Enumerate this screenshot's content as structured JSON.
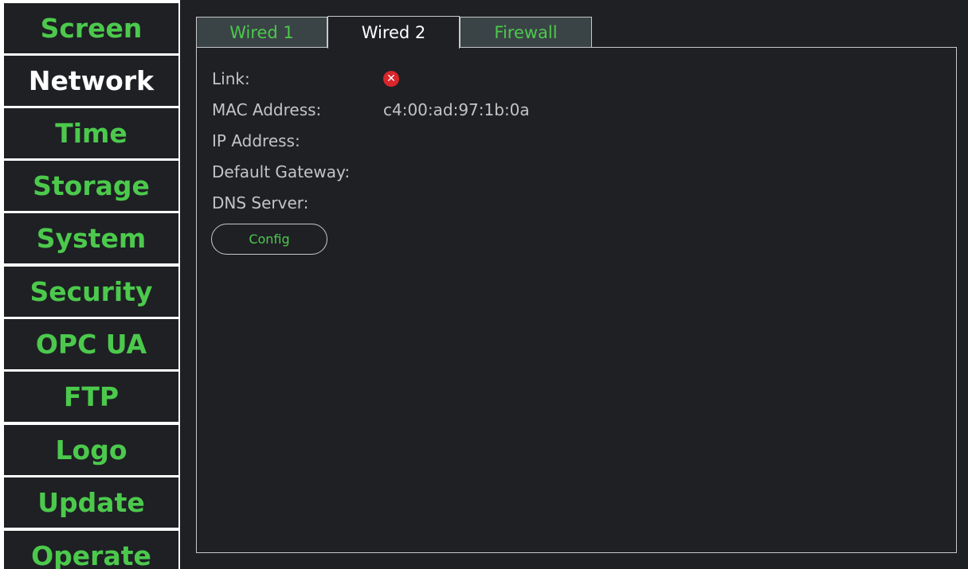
{
  "sidebar": {
    "items": [
      {
        "label": "Screen"
      },
      {
        "label": "Network"
      },
      {
        "label": "Time"
      },
      {
        "label": "Storage"
      },
      {
        "label": "System"
      },
      {
        "label": "Security"
      },
      {
        "label": "OPC UA"
      },
      {
        "label": "FTP"
      },
      {
        "label": "Logo"
      },
      {
        "label": "Update"
      },
      {
        "label": "Operate"
      }
    ],
    "active": "Network"
  },
  "tabs": [
    {
      "label": "Wired 1"
    },
    {
      "label": "Wired 2"
    },
    {
      "label": "Firewall"
    }
  ],
  "active_tab": "Wired 2",
  "network": {
    "link_label": "Link:",
    "link_status_icon": "error-circle-icon",
    "mac_label": "MAC Address:",
    "mac_value": "c4:00:ad:97:1b:0a",
    "ip_label": "IP Address:",
    "ip_value": "",
    "gateway_label": "Default Gateway:",
    "gateway_value": "",
    "dns_label": "DNS Server:",
    "dns_value": "",
    "config_label": "Config"
  },
  "colors": {
    "accent": "#4cc94c",
    "background": "#1e2024",
    "inactive_tab": "#3a4446",
    "error": "#d8262b",
    "border": "#c8c8c8"
  }
}
